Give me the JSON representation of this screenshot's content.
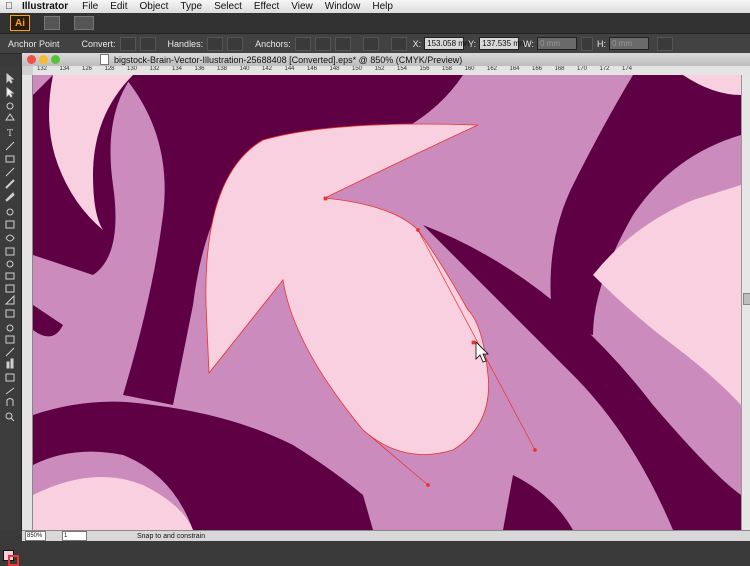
{
  "menubar": {
    "app": "Illustrator",
    "items": [
      "File",
      "Edit",
      "Object",
      "Type",
      "Select",
      "Effect",
      "View",
      "Window",
      "Help"
    ]
  },
  "appbar": {
    "logo": "Ai"
  },
  "control": {
    "mode_label": "Anchor Point",
    "convert_label": "Convert:",
    "handles_label": "Handles:",
    "anchors_label": "Anchors:",
    "x_label": "X:",
    "x_value": "153.058 mm",
    "y_label": "Y:",
    "y_value": "137.535 mm",
    "w_label": "W:",
    "w_value": "0 mm",
    "h_label": "H:",
    "h_value": "0 mm"
  },
  "document": {
    "title": "bigstock-Brain-Vector-Illustration-25688408 [Converted].eps* @ 850% (CMYK/Preview)"
  },
  "ruler": {
    "ticks": [
      "132",
      "134",
      "126",
      "128",
      "130",
      "132",
      "134",
      "136",
      "138",
      "140",
      "142",
      "144",
      "146",
      "148",
      "150",
      "152",
      "154",
      "156",
      "158",
      "160",
      "162",
      "164",
      "166",
      "168",
      "170",
      "172",
      "174"
    ]
  },
  "status": {
    "zoom": "850%",
    "page": "1",
    "message": "Snap to and constrain"
  },
  "colors": {
    "bg_pink": "#cb8cbd",
    "dark_purple": "#5f0045",
    "light_pink": "#f9d0df",
    "path_red": "#e8312d"
  }
}
